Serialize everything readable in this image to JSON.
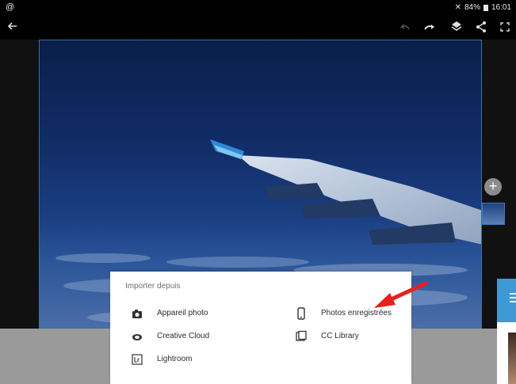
{
  "status_bar": {
    "battery": "84%",
    "time": "16:01",
    "left_icon": "app-notification-icon",
    "mute_icon": "mute-icon",
    "battery_icon": "battery-icon"
  },
  "toolbar": {
    "back_icon": "back-arrow-icon",
    "undo_icon": "undo-icon",
    "redo_icon": "redo-icon",
    "layers_icon": "layers-icon",
    "share_icon": "share-icon",
    "fullscreen_icon": "fullscreen-icon"
  },
  "import_sheet": {
    "title": "Importer depuis",
    "options": [
      {
        "label": "Appareil photo",
        "icon": "camera-icon"
      },
      {
        "label": "Photos enregistrées",
        "icon": "phone-icon"
      },
      {
        "label": "Creative Cloud",
        "icon": "creative-cloud-icon"
      },
      {
        "label": "CC Library",
        "icon": "library-icon"
      },
      {
        "label": "Lightroom",
        "icon": "lightroom-icon"
      }
    ]
  },
  "colors": {
    "accent": "#3e9ad6",
    "annotation_arrow": "#e8201c",
    "selection_border": "#3a6fa0"
  }
}
